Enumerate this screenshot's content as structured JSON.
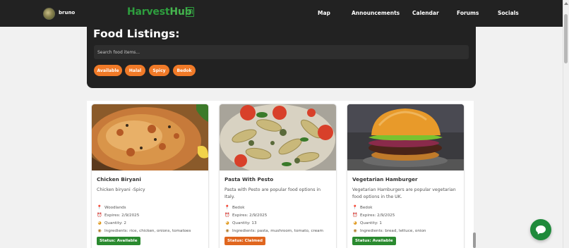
{
  "nav": {
    "username": "bruno",
    "logo_part1": "Harvest",
    "logo_part2": "Hub",
    "links": [
      "Map",
      "Announcements",
      "Calendar",
      "Forums",
      "Socials"
    ]
  },
  "panel": {
    "title": "Food Listings:",
    "search_placeholder": "Search food items...",
    "filters": [
      "Available",
      "Halal",
      "Spicy",
      "Bedok"
    ]
  },
  "cards": [
    {
      "title": "Chicken Biryani",
      "description": "Chicken biryani -Spicy",
      "location": "Woodlands",
      "expires": "Expires: 2/9/2025",
      "quantity": "Quantity: 2",
      "ingredients": "Ingredients: rice, chicken, onions, tomatoes",
      "status": "Status: Available"
    },
    {
      "title": "Pasta With Pesto",
      "description": "Pasta with Pesto are popular food options in Italy.",
      "location": "Bedok",
      "expires": "Expires: 2/9/2025",
      "quantity": "Quantity: 13",
      "ingredients": "Ingredients: pasta, mushroom, tomato, cream",
      "status": "Status: Claimed"
    },
    {
      "title": "Vegetarian Hamburger",
      "description": "Vegetarian Hamburgers are popular vegetarian food options in the UK.",
      "location": "Bedok",
      "expires": "Expires: 2/9/2025",
      "quantity": "Quantity: 1",
      "ingredients": "Ingredients: bread, lettuce, onion",
      "status": "Status: Available"
    }
  ],
  "colors": {
    "nav_bg": "#222222",
    "accent_orange": "#f07a28",
    "brand_green": "#2e9e3e",
    "status_available": "#2a8a2f",
    "status_claimed": "#e0661f"
  },
  "icons": [
    "pin-icon",
    "alarm-clock-icon",
    "quantity-icon",
    "ingredients-icon",
    "chat-icon"
  ]
}
